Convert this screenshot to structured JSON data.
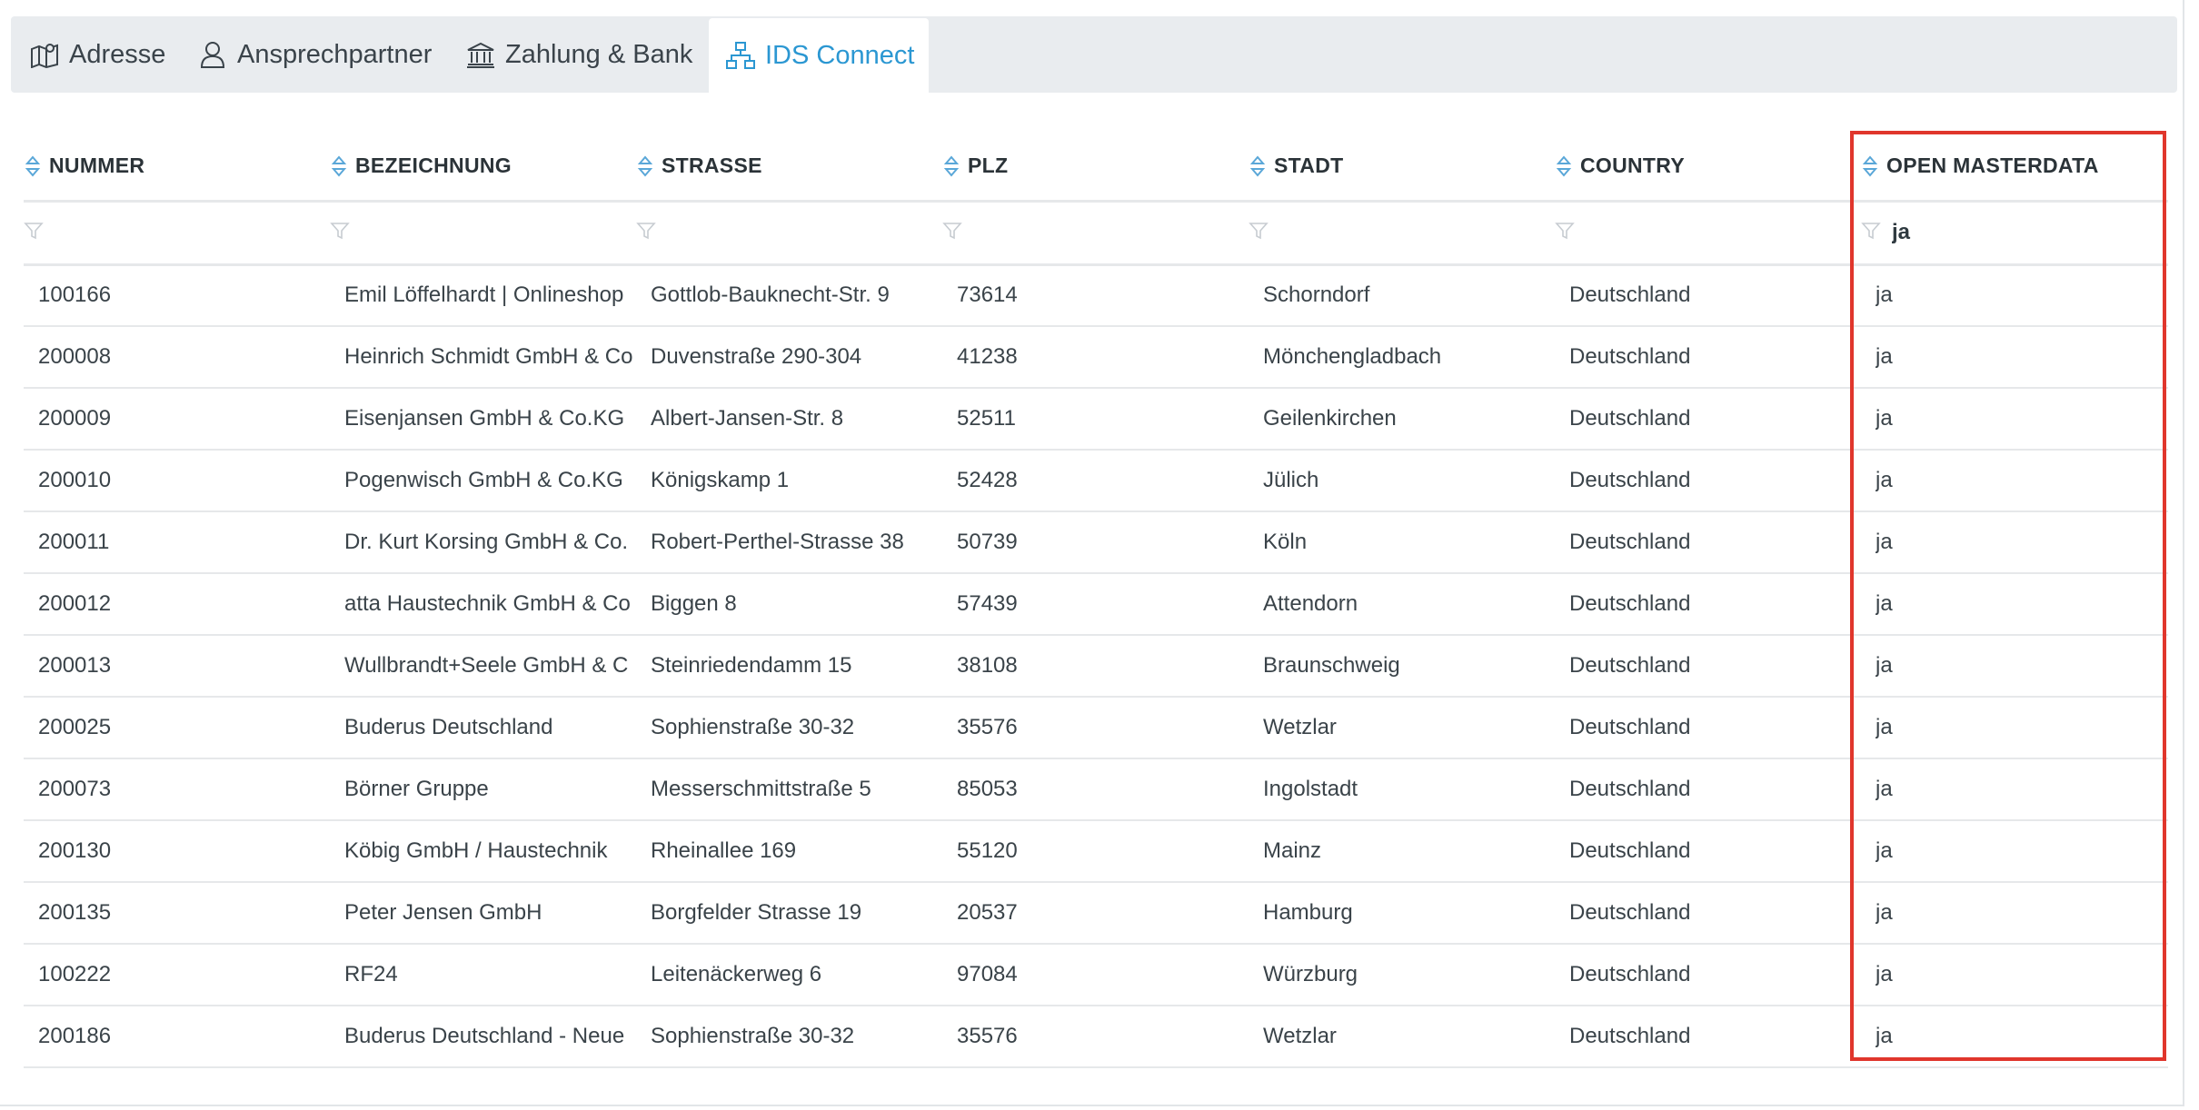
{
  "tabs": [
    {
      "label": "Adresse",
      "icon": "map-icon"
    },
    {
      "label": "Ansprechpartner",
      "icon": "user-icon"
    },
    {
      "label": "Zahlung & Bank",
      "icon": "bank-icon"
    },
    {
      "label": "IDS Connect",
      "icon": "network-icon",
      "active": true
    }
  ],
  "table": {
    "columns": [
      "NUMMER",
      "BEZEICHNUNG",
      "STRASSE",
      "PLZ",
      "STADT",
      "COUNTRY",
      "OPEN MASTERDATA"
    ],
    "filters": [
      "",
      "",
      "",
      "",
      "",
      "",
      "ja"
    ],
    "rows": [
      [
        "100166",
        "Emil Löffelhardt | Onlineshop",
        "Gottlob-Bauknecht-Str. 9",
        "73614",
        "Schorndorf",
        "Deutschland",
        "ja"
      ],
      [
        "200008",
        "Heinrich Schmidt GmbH & Co",
        "Duvenstraße 290-304",
        "41238",
        "Mönchengladbach",
        "Deutschland",
        "ja"
      ],
      [
        "200009",
        "Eisenjansen GmbH & Co.KG",
        "Albert-Jansen-Str. 8",
        "52511",
        "Geilenkirchen",
        "Deutschland",
        "ja"
      ],
      [
        "200010",
        "Pogenwisch GmbH & Co.KG",
        "Königskamp 1",
        "52428",
        "Jülich",
        "Deutschland",
        "ja"
      ],
      [
        "200011",
        "Dr. Kurt Korsing GmbH & Co.",
        "Robert-Perthel-Strasse 38",
        "50739",
        "Köln",
        "Deutschland",
        "ja"
      ],
      [
        "200012",
        "atta Haustechnik GmbH & Co",
        "Biggen 8",
        "57439",
        "Attendorn",
        "Deutschland",
        "ja"
      ],
      [
        "200013",
        "Wullbrandt+Seele GmbH & C",
        "Steinriedendamm 15",
        "38108",
        "Braunschweig",
        "Deutschland",
        "ja"
      ],
      [
        "200025",
        "Buderus Deutschland",
        "Sophienstraße 30-32",
        "35576",
        "Wetzlar",
        "Deutschland",
        "ja"
      ],
      [
        "200073",
        "Börner Gruppe",
        "Messerschmittstraße 5",
        "85053",
        "Ingolstadt",
        "Deutschland",
        "ja"
      ],
      [
        "200130",
        "Köbig GmbH / Haustechnik",
        "Rheinallee 169",
        "55120",
        "Mainz",
        "Deutschland",
        "ja"
      ],
      [
        "200135",
        "Peter Jensen GmbH",
        "Borgfelder Strasse 19",
        "20537",
        "Hamburg",
        "Deutschland",
        "ja"
      ],
      [
        "100222",
        "RF24",
        "Leitenäckerweg 6",
        "97084",
        "Würzburg",
        "Deutschland",
        "ja"
      ],
      [
        "200186",
        "Buderus Deutschland - Neue",
        "Sophienstraße 30-32",
        "35576",
        "Wetzlar",
        "Deutschland",
        "ja"
      ]
    ]
  },
  "colors": {
    "accent": "#2b97d2",
    "highlight": "#e0362c",
    "tabbar": "#e9ecef"
  }
}
